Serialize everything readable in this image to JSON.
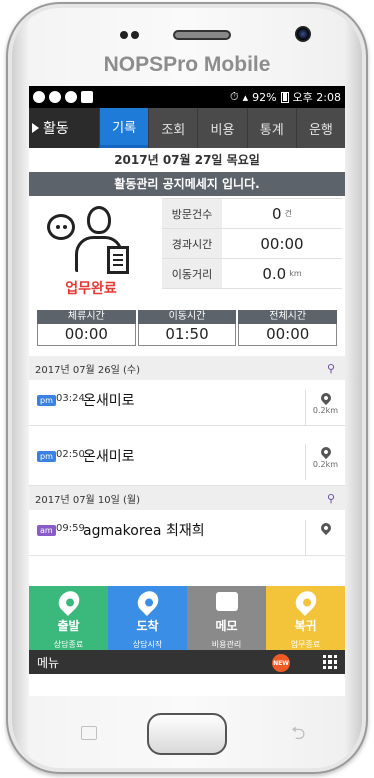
{
  "device": {
    "brand": "NOPSPro Mobile"
  },
  "status_bar": {
    "time_info": "⏱ 92% 国 오후 2:08",
    "battery_text": "92%",
    "time": "오후 2:08"
  },
  "nav": {
    "section_label": "활동",
    "tabs": [
      {
        "label": "기록",
        "active": true
      },
      {
        "label": "조회"
      },
      {
        "label": "비용"
      },
      {
        "label": "통계"
      },
      {
        "label": "운행"
      }
    ]
  },
  "header": {
    "date": "2017년 07월 27일 목요일",
    "notice": "활동관리 공지메세지 입니다."
  },
  "summary": {
    "work_status": "업무완료",
    "stats": [
      {
        "label": "방문건수",
        "value": "0",
        "unit": "건"
      },
      {
        "label": "경과시간",
        "value": "00:00",
        "unit": ""
      },
      {
        "label": "이동거리",
        "value": "0.0",
        "unit": "km"
      }
    ],
    "times": [
      {
        "label": "체류시간",
        "value": "00:00"
      },
      {
        "label": "이동시간",
        "value": "01:50"
      },
      {
        "label": "전체시간",
        "value": "00:00"
      }
    ]
  },
  "days": [
    {
      "date": "2017년 07월 26일 (수)",
      "entries": [
        {
          "ampm": "pm",
          "time": "03:24",
          "place": "온새미로",
          "distance": "0.2km"
        },
        {
          "ampm": "pm",
          "time": "02:50",
          "place": "온새미로",
          "distance": "0.2km"
        }
      ]
    },
    {
      "date": "2017년 07월 10일 (월)",
      "entries": [
        {
          "ampm": "am",
          "time": "09:59",
          "place": "agmakorea 최재희",
          "distance": ""
        }
      ]
    }
  ],
  "bottom_menu": [
    {
      "title": "출발",
      "sub": "상담종료",
      "color": "#3bb97d"
    },
    {
      "title": "도착",
      "sub": "상담시작",
      "color": "#3a8ee6"
    },
    {
      "title": "메모",
      "sub": "비용관리",
      "color": "#8a8a8a"
    },
    {
      "title": "복귀",
      "sub": "업무종료",
      "color": "#f3c43a"
    }
  ],
  "bottom_bar": {
    "menu_label": "메뉴",
    "new_badge": "NEW"
  },
  "colors": {
    "accent": "#1e7bd8",
    "dark_bar": "#2b2b2b",
    "status_red": "#e53935"
  }
}
